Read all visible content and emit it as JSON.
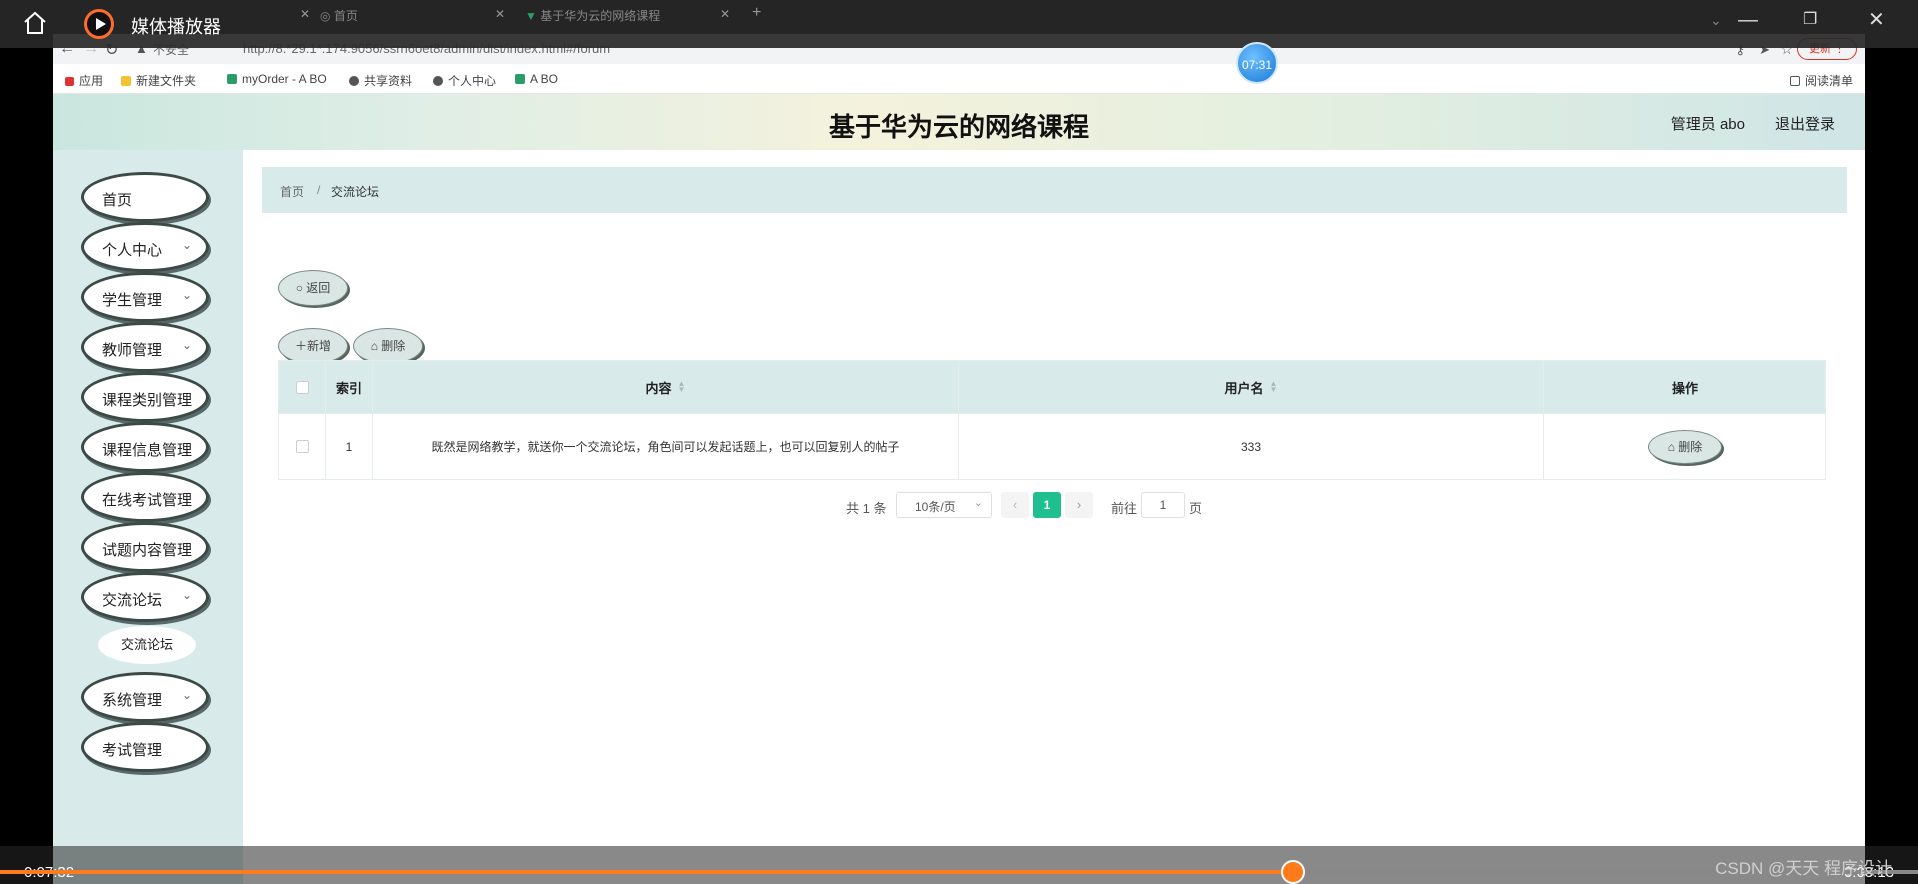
{
  "player": {
    "title": "媒体播放器",
    "time_bubble": "07:31",
    "time_current": "0:07:32",
    "time_total": "0:03:13",
    "progress_fraction": 0.674,
    "watermark": "CSDN @天天 程序设计"
  },
  "browser": {
    "tabs": [
      {
        "label": "首页"
      },
      {
        "label": "基于华为云的网络课程"
      }
    ],
    "insecure_label": "不安全",
    "url": "http://8.*29.1*.174:9056/ssrn6oet8/admin/dist/index.html#/forum",
    "update_label": "更新",
    "bookmarks": [
      {
        "label": "应用"
      },
      {
        "label": "新建文件夹"
      },
      {
        "label": "myOrder - A BO"
      },
      {
        "label": "共享资料"
      },
      {
        "label": "个人中心"
      },
      {
        "label": "A BO"
      }
    ],
    "reading_list": "阅读清单"
  },
  "header": {
    "title": "基于华为云的网络课程",
    "user": "管理员 abo",
    "logout": "退出登录"
  },
  "sidebar": {
    "items": [
      {
        "label": "首页",
        "has_chevron": false
      },
      {
        "label": "个人中心",
        "has_chevron": true
      },
      {
        "label": "学生管理",
        "has_chevron": true
      },
      {
        "label": "教师管理",
        "has_chevron": true
      },
      {
        "label": "课程类别管理",
        "has_chevron": false
      },
      {
        "label": "课程信息管理",
        "has_chevron": false
      },
      {
        "label": "在线考试管理",
        "has_chevron": false
      },
      {
        "label": "试题内容管理",
        "has_chevron": false
      },
      {
        "label": "交流论坛",
        "has_chevron": true
      },
      {
        "label": "系统管理",
        "has_chevron": true
      },
      {
        "label": "考试管理",
        "has_chevron": false
      }
    ],
    "sub_item": "交流论坛"
  },
  "breadcrumb": {
    "home": "首页",
    "separator": "/",
    "current": "交流论坛"
  },
  "toolbar": {
    "back": "返回",
    "add": "新增",
    "delete": "删除"
  },
  "table": {
    "columns": [
      "索引",
      "内容",
      "用户名",
      "操作"
    ],
    "rows": [
      {
        "index": "1",
        "content": "既然是网络教学，就送你一个交流论坛，角色间可以发起话题上，也可以回复别人的帖子",
        "username": "333",
        "action": "删除"
      }
    ]
  },
  "pager": {
    "total": "共 1 条",
    "page_size": "10条/页",
    "current_page": "1",
    "goto_label": "前往",
    "goto_value": "1",
    "goto_suffix": "页"
  },
  "colors": {
    "accent": "#1fbf8f",
    "sidebar_bg": "#d9eaea",
    "progress": "#ff7a1a"
  }
}
